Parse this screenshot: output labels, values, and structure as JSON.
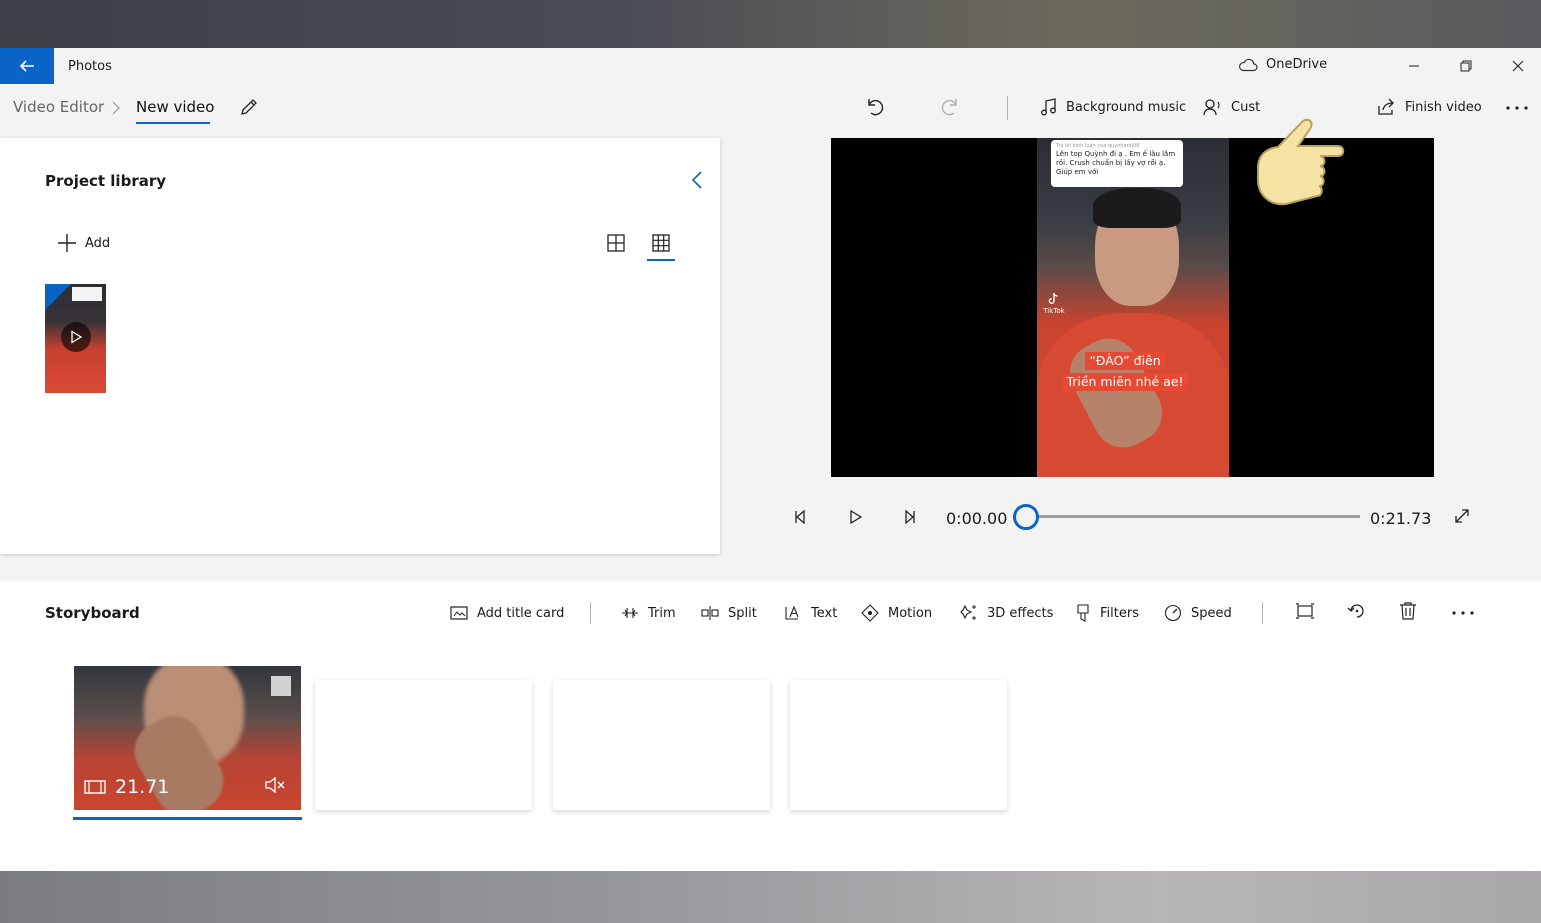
{
  "window": {
    "app_title": "Photos",
    "onedrive_label": "OneDrive"
  },
  "toolbar": {
    "breadcrumb_root": "Video Editor",
    "breadcrumb_current": "New video",
    "background_music_label": "Background music",
    "custom_audio_label": "Cust",
    "finish_video_label": "Finish video"
  },
  "library": {
    "title": "Project library",
    "add_label": "Add"
  },
  "preview": {
    "bubble_header": "Trả lời bình luận của quynhanh08",
    "bubble_text": "Lên top Quỳnh đi ạ . Em ế lâu lắm rồi. Crush chuẩn bị lấy vợ rồi ạ. Giúp em với",
    "tiktok_label": "TikTok",
    "caption_line1": "“ĐÀO” điên",
    "caption_line2": "Triền miên nhé ae!",
    "time_current": "0:00.00",
    "time_total": "0:21.73",
    "progress_fraction": 0.0
  },
  "storyboard": {
    "title": "Storyboard",
    "add_title_card_label": "Add title card",
    "trim_label": "Trim",
    "split_label": "Split",
    "text_label": "Text",
    "motion_label": "Motion",
    "effects_label": "3D effects",
    "filters_label": "Filters",
    "speed_label": "Speed",
    "clip_duration": "21.71"
  },
  "colors": {
    "accent": "#0a64c8",
    "caption_red": "#e74a34"
  }
}
